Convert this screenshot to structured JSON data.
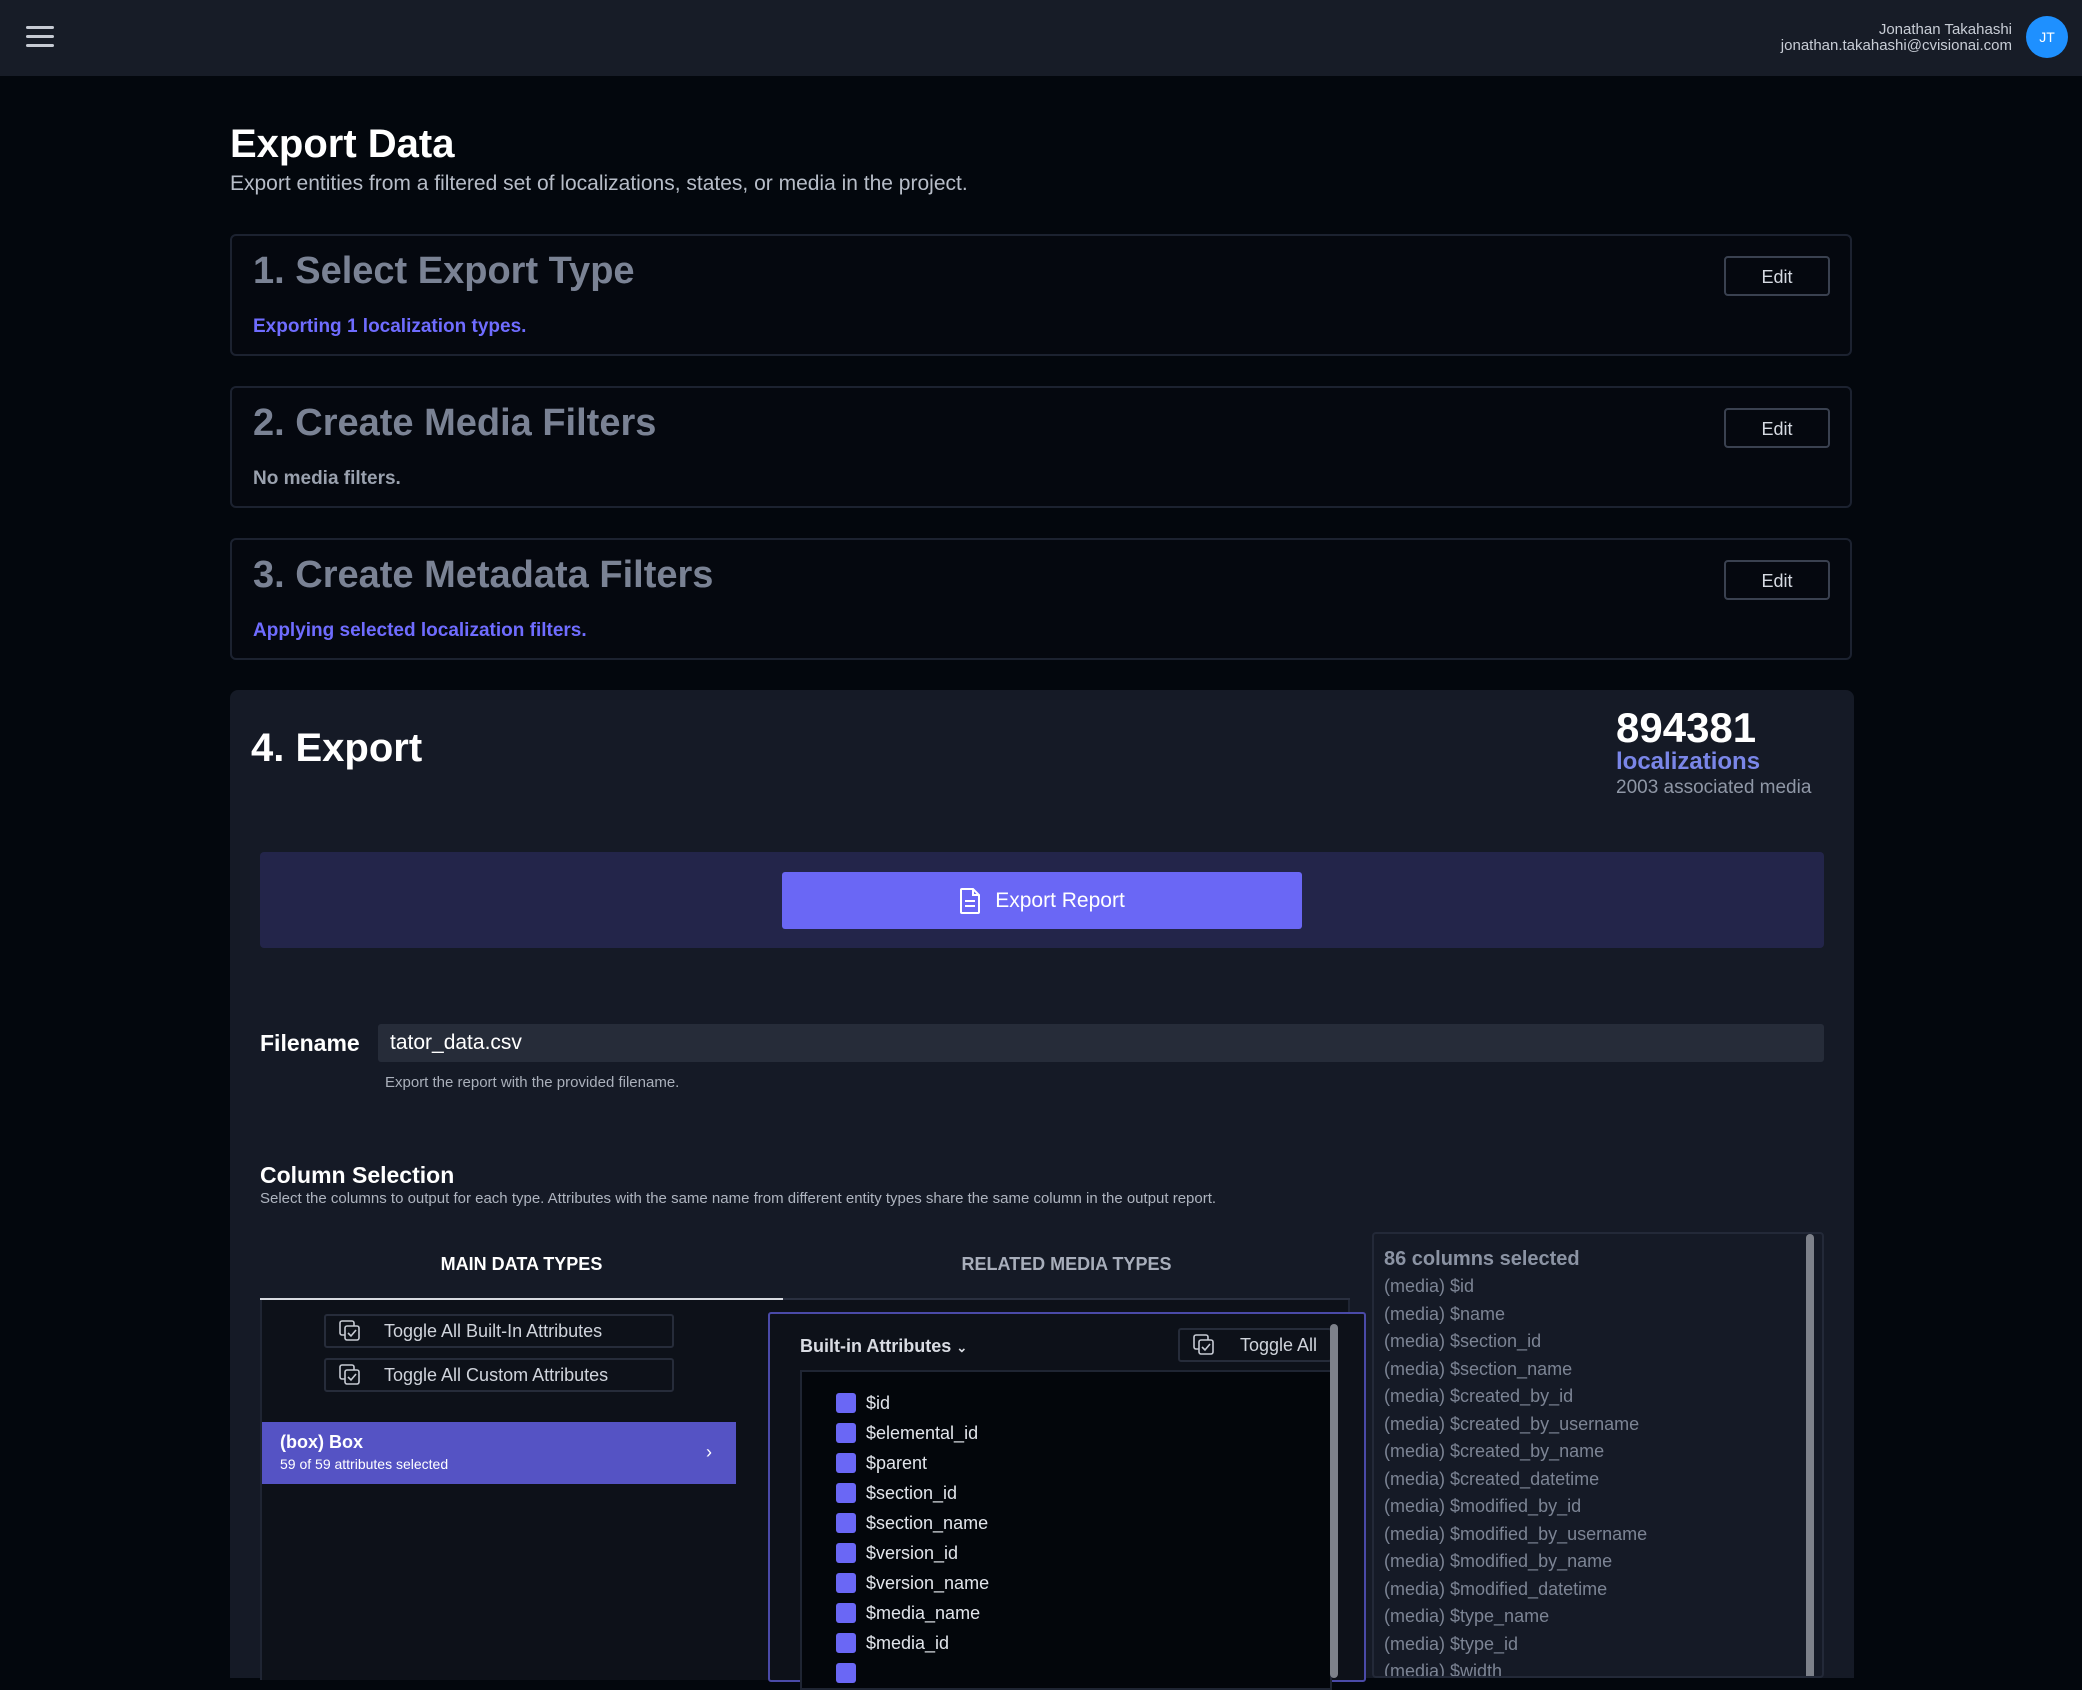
{
  "header": {
    "user_name": "Jonathan Takahashi",
    "user_email": "jonathan.takahashi@cvisionai.com",
    "avatar_initials": "JT"
  },
  "page": {
    "title": "Export Data",
    "subtitle": "Export entities from a filtered set of localizations, states, or media in the project."
  },
  "steps": [
    {
      "title": "1. Select Export Type",
      "note": "Exporting 1 localization types.",
      "edit_label": "Edit"
    },
    {
      "title": "2. Create Media Filters",
      "note": "No media filters.",
      "edit_label": "Edit"
    },
    {
      "title": "3. Create Metadata Filters",
      "note": "Applying selected localization filters.",
      "edit_label": "Edit"
    }
  ],
  "export": {
    "title": "4. Export",
    "count": "894381",
    "count_unit": "localizations",
    "media_count": "2003 associated media",
    "report_button": "Export Report",
    "filename_label": "Filename",
    "filename_value": "tator_data.csv",
    "filename_help": "Export the report with the provided filename."
  },
  "column_selection": {
    "title": "Column Selection",
    "description": "Select the columns to output for each type. Attributes with the same name from different entity types share the same column in the output report.",
    "tabs": [
      "MAIN DATA TYPES",
      "RELATED MEDIA TYPES"
    ],
    "toggle_builtin": "Toggle All Built-In Attributes",
    "toggle_custom": "Toggle All Custom Attributes",
    "type_item": {
      "name": "(box) Box",
      "sub": "59 of 59 attributes selected"
    },
    "attr_header": "Built-in Attributes",
    "toggle_all": "Toggle All",
    "attributes": [
      "$id",
      "$elemental_id",
      "$parent",
      "$section_id",
      "$section_name",
      "$version_id",
      "$version_name",
      "$media_name",
      "$media_id"
    ],
    "selected_title": "86 columns selected",
    "selected_columns": [
      "(media) $id",
      "(media) $name",
      "(media) $section_id",
      "(media) $section_name",
      "(media) $created_by_id",
      "(media) $created_by_username",
      "(media) $created_by_name",
      "(media) $created_datetime",
      "(media) $modified_by_id",
      "(media) $modified_by_username",
      "(media) $modified_by_name",
      "(media) $modified_datetime",
      "(media) $type_name",
      "(media) $type_id",
      "(media) $width"
    ]
  },
  "colors": {
    "accent": "#6a67f5",
    "background": "#03070d",
    "panel": "#151a26"
  }
}
